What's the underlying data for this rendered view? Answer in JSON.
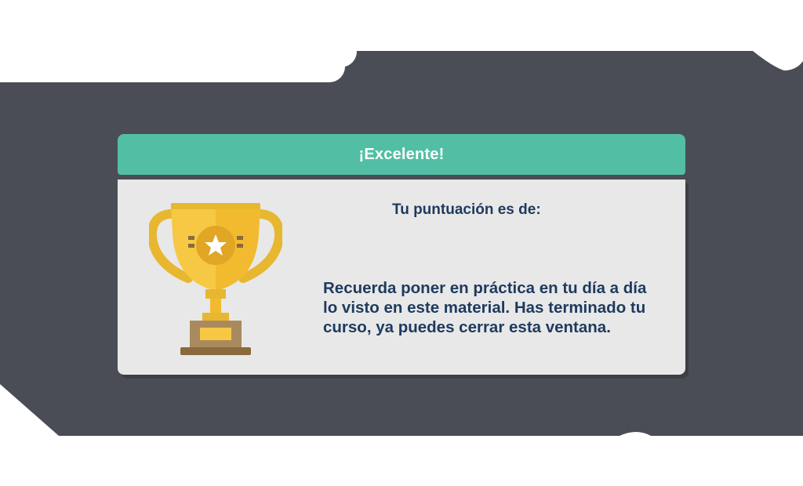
{
  "dialog": {
    "title": "¡Excelente!",
    "score_label": "Tu puntuación es de:",
    "message": "Recuerda poner en práctica en tu día a día lo visto en este material. Has terminado tu curso, ya puedes cerrar esta ventana."
  },
  "icons": {
    "trophy": "trophy-icon",
    "star": "star-icon"
  },
  "colors": {
    "backdrop": "#4a4d55",
    "header": "#52bfa5",
    "body": "#e8e8e8",
    "text": "#1e3a5f",
    "trophy_gold": "#f7c843",
    "trophy_base": "#a98a5e"
  }
}
